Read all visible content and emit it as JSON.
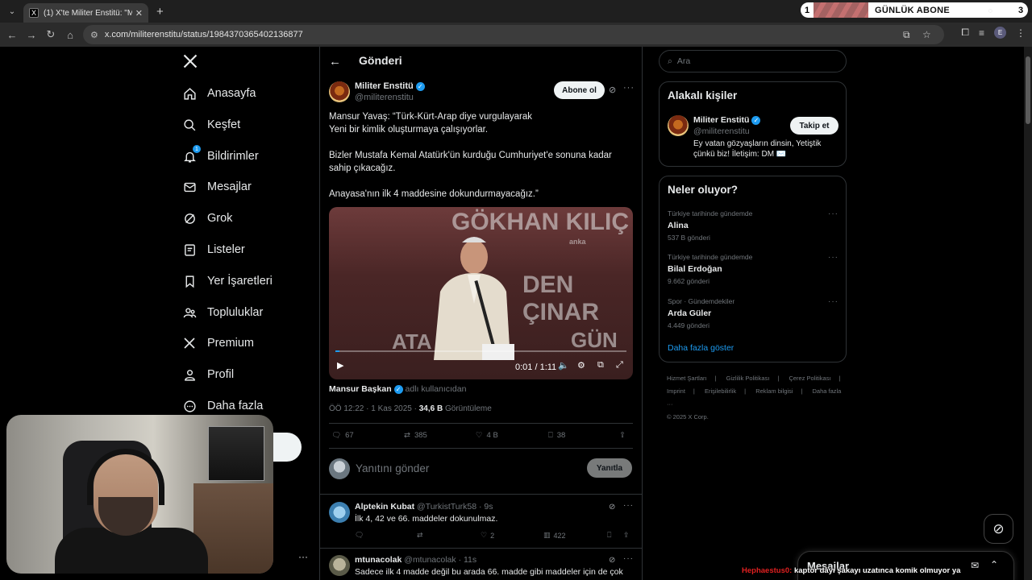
{
  "browser": {
    "tab_title": "(1) X'te Militer Enstitü: \"Mansur",
    "url": "x.com/militerenstitu/status/1984370365402136877"
  },
  "subscriber_widget": {
    "left_value": "1",
    "label": "GÜNLÜK ABONE",
    "right_value": "3",
    "progress": 0.25
  },
  "nav": {
    "items": [
      {
        "label": "Anasayfa",
        "icon": "home-icon"
      },
      {
        "label": "Keşfet",
        "icon": "search-icon"
      },
      {
        "label": "Bildirimler",
        "icon": "bell-icon",
        "badge": "1"
      },
      {
        "label": "Mesajlar",
        "icon": "mail-icon"
      },
      {
        "label": "Grok",
        "icon": "grok-icon"
      },
      {
        "label": "Listeler",
        "icon": "list-icon"
      },
      {
        "label": "Yer İşaretleri",
        "icon": "bookmark-icon"
      },
      {
        "label": "Topluluklar",
        "icon": "people-icon"
      },
      {
        "label": "Premium",
        "icon": "x-logo-icon"
      },
      {
        "label": "Profil",
        "icon": "person-icon"
      },
      {
        "label": "Daha fazla",
        "icon": "more-circle-icon"
      }
    ]
  },
  "header": {
    "title": "Gönderi"
  },
  "post": {
    "author": "Militer Enstitü",
    "handle": "@militerenstitu",
    "subscribe_label": "Abone ol",
    "text": [
      "Mansur Yavaş: “Türk-Kürt-Arap diye vurgulayarak\nYeni bir kimlik oluşturmaya çalışıyorlar.",
      "Bizler Mustafa Kemal Atatürk'ün kurduğu Cumhuriyet'e sonuna kadar sahip çıkacağız.",
      "Anayasa'nın ilk 4 maddesine dokundurmayacağız.”"
    ],
    "video": {
      "time": "0:01 / 1:11",
      "progress": 0.014,
      "overlay_text_1": "GÖKHAN KILIÇ",
      "overlay_text_2": "DEN ÇINAR",
      "overlay_text_3": "ATA",
      "overlay_text_4": "GÜN",
      "watermark": "anka"
    },
    "attribution_name": "Mansur Başkan",
    "attribution_suffix": "adlı kullanıcıdan",
    "timestamp": "ÖÖ 12:22 · 1 Kas 2025 · ",
    "views_count": "34,6 B",
    "views_label": "Görüntüleme",
    "stats": {
      "replies": "67",
      "reposts": "385",
      "likes": "4 B",
      "bookmarks": "38"
    }
  },
  "reply_box": {
    "placeholder": "Yanıtını gönder",
    "button": "Yanıtla"
  },
  "comments": [
    {
      "name": "Alptekin Kubat",
      "handle": "@TurkistTurk58",
      "time": "· 9s",
      "text": "İlk 4, 42 ve 66. maddeler dokunulmaz.",
      "likes": "2",
      "views": "422"
    },
    {
      "name": "mtunacolak",
      "handle": "@mtunacolak",
      "time": "· 11s",
      "text": "Sadece ilk 4 madde değil bu arada 66. madde gibi maddeler için de çok"
    }
  ],
  "search": {
    "placeholder": "Ara"
  },
  "related": {
    "title": "Alakalı kişiler",
    "author": "Militer Enstitü",
    "handle": "@militerenstitu",
    "follow_label": "Takip et",
    "bio": "Ey vatan gözyaşların dinsin, Yetiştik çünkü biz! İletişim: DM ✉️"
  },
  "trends": {
    "title": "Neler oluyor?",
    "items": [
      {
        "category": "Türkiye tarihinde gündemde",
        "name": "Alina",
        "count": "537 B gönderi"
      },
      {
        "category": "Türkiye tarihinde gündemde",
        "name": "Bilal Erdoğan",
        "count": "9.662 gönderi"
      },
      {
        "category": "Spor · Gündemdekiler",
        "name": "Arda Güler",
        "count": "4.449 gönderi"
      }
    ],
    "show_more": "Daha fazla göster"
  },
  "footer": {
    "links": [
      "Hizmet Şartları",
      "|",
      "Gizlilik Politikası",
      "|",
      "Çerez Politikası",
      "|",
      "Imprint",
      "|",
      "Erişilebilirlik",
      "|",
      "Reklam bilgisi",
      "|",
      "Daha fazla ···"
    ],
    "copyright": "© 2025 X Corp."
  },
  "messages_drawer": {
    "title": "Mesajlar"
  },
  "chat_overlay": {
    "user": "Hephaestus0:",
    "message": " kaptor dayı şakayı uzatınca komik olmuyor ya"
  },
  "colors": {
    "accent": "#1d9bf0",
    "background": "#000000",
    "border": "#2f3336",
    "muted_text": "#71767b"
  }
}
